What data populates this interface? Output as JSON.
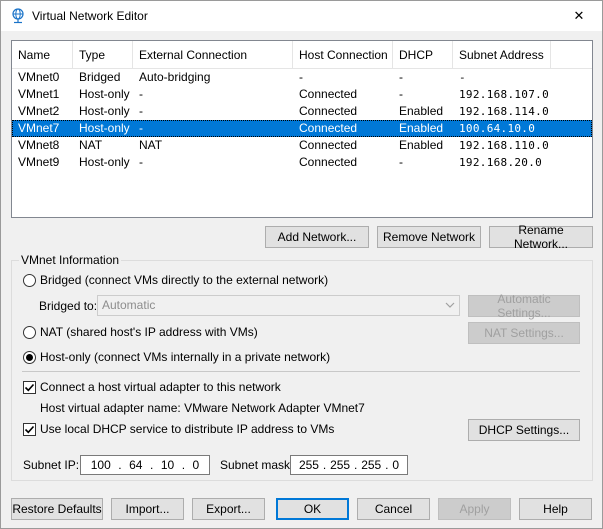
{
  "window": {
    "title": "Virtual Network Editor",
    "icon": "globe-network-icon",
    "close_glyph": "✕"
  },
  "network_table": {
    "columns": [
      "Name",
      "Type",
      "External Connection",
      "Host Connection",
      "DHCP",
      "Subnet Address"
    ],
    "rows": [
      {
        "name": "VMnet0",
        "type": "Bridged",
        "external": "Auto-bridging",
        "host": "-",
        "dhcp": "-",
        "subnet": "-"
      },
      {
        "name": "VMnet1",
        "type": "Host-only",
        "external": "-",
        "host": "Connected",
        "dhcp": "-",
        "subnet": "192.168.107.0"
      },
      {
        "name": "VMnet2",
        "type": "Host-only",
        "external": "-",
        "host": "Connected",
        "dhcp": "Enabled",
        "subnet": "192.168.114.0"
      },
      {
        "name": "VMnet7",
        "type": "Host-only",
        "external": "-",
        "host": "Connected",
        "dhcp": "Enabled",
        "subnet": "100.64.10.0"
      },
      {
        "name": "VMnet8",
        "type": "NAT",
        "external": "NAT",
        "host": "Connected",
        "dhcp": "Enabled",
        "subnet": "192.168.110.0"
      },
      {
        "name": "VMnet9",
        "type": "Host-only",
        "external": "-",
        "host": "Connected",
        "dhcp": "-",
        "subnet": "192.168.20.0"
      }
    ],
    "selected_row": "VMnet7"
  },
  "table_buttons": {
    "add": "Add Network...",
    "remove": "Remove Network",
    "rename": "Rename Network..."
  },
  "vmnet_info": {
    "legend": "VMnet Information",
    "bridged_label": "Bridged (connect VMs directly to the external network)",
    "bridged_to_label": "Bridged to:",
    "bridged_to_value": "Automatic",
    "auto_settings": "Automatic Settings...",
    "nat_label": "NAT (shared host's IP address with VMs)",
    "nat_settings": "NAT Settings...",
    "hostonly_label": "Host-only (connect VMs internally in a private network)",
    "selected_mode": "host-only",
    "connect_adapter_label": "Connect a host virtual adapter to this network",
    "connect_adapter_checked": true,
    "adapter_name_text": "Host virtual adapter name: VMware Network Adapter VMnet7",
    "dhcp_label": "Use local DHCP service to distribute IP address to VMs",
    "dhcp_checked": true,
    "dhcp_settings": "DHCP Settings...",
    "subnet_ip_label": "Subnet IP:",
    "subnet_ip": [
      "100",
      "64",
      "10",
      "0"
    ],
    "subnet_mask_label": "Subnet mask:",
    "subnet_mask": [
      "255",
      "255",
      "255",
      "0"
    ]
  },
  "footer_buttons": {
    "restore": "Restore Defaults",
    "import": "Import...",
    "export": "Export...",
    "ok": "OK",
    "cancel": "Cancel",
    "apply": "Apply",
    "help": "Help"
  },
  "colors": {
    "selection": "#0078d7",
    "window_bg": "#f0f0f0"
  }
}
